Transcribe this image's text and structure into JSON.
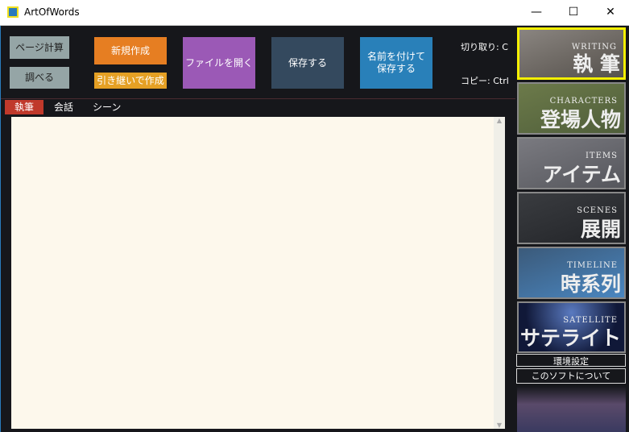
{
  "window": {
    "title": "ArtOfWords",
    "minimize": "—",
    "maximize": "☐",
    "close": "✕"
  },
  "toolbar": {
    "page_calc": "ページ計算",
    "lookup": "調べる",
    "new": "新規作成",
    "inherit_new": "引き継いで作成",
    "open": "ファイルを開く",
    "save": "保存する",
    "save_as_1": "名前を付けて",
    "save_as_2": "保存する",
    "shortcut_cut": "切り取り: C",
    "shortcut_copy": "コピー: Ctrl"
  },
  "tabs": [
    {
      "label": "執筆",
      "active": true
    },
    {
      "label": "会話",
      "active": false
    },
    {
      "label": "シーン",
      "active": false
    }
  ],
  "editor": {
    "content": ""
  },
  "sidebar": {
    "tiles": [
      {
        "en": "WRITING",
        "jp": "執 筆",
        "selected": true
      },
      {
        "en": "CHARACTERS",
        "jp": "登場人物"
      },
      {
        "en": "ITEMS",
        "jp": "アイテム"
      },
      {
        "en": "SCENES",
        "jp": "展開"
      },
      {
        "en": "TIMELINE",
        "jp": "時系列"
      },
      {
        "en": "SATELLITE",
        "jp": "サテライト"
      }
    ],
    "settings": "環境設定",
    "about": "このソフトについて"
  },
  "colors": {
    "new": "#e67e22",
    "inherit": "#e5a024",
    "open": "#9b59b6",
    "save": "#34495e",
    "save_as": "#2980b9",
    "active_tab": "#c0392b",
    "selected_tile": "#f5f000"
  }
}
